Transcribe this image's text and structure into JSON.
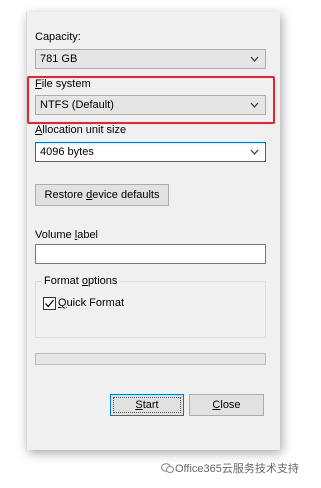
{
  "capacity": {
    "label": "Capacity:",
    "value": "781 GB"
  },
  "file_system": {
    "label_first": "F",
    "label_rest": "ile system",
    "value": "NTFS (Default)"
  },
  "allocation": {
    "label_first": "A",
    "label_rest": "llocation unit size",
    "value": "4096 bytes"
  },
  "restore": {
    "label_pre": "Restore ",
    "label_key": "d",
    "label_post": "evice defaults"
  },
  "volume": {
    "label_pre": "Volume ",
    "label_key": "l",
    "label_post": "abel",
    "value": ""
  },
  "format_options": {
    "title_pre": "Format ",
    "title_key": "o",
    "title_post": "ptions",
    "quick_format_key": "Q",
    "quick_format_rest": "uick Format",
    "quick_format_checked": true
  },
  "progress": {
    "value": 0
  },
  "buttons": {
    "start_key": "S",
    "start_rest": "tart",
    "close_key": "C",
    "close_rest": "lose"
  },
  "watermark": {
    "text": "Office365云服务技术支持"
  },
  "colors": {
    "highlight": "#e8262a",
    "accent": "#0078d7"
  }
}
